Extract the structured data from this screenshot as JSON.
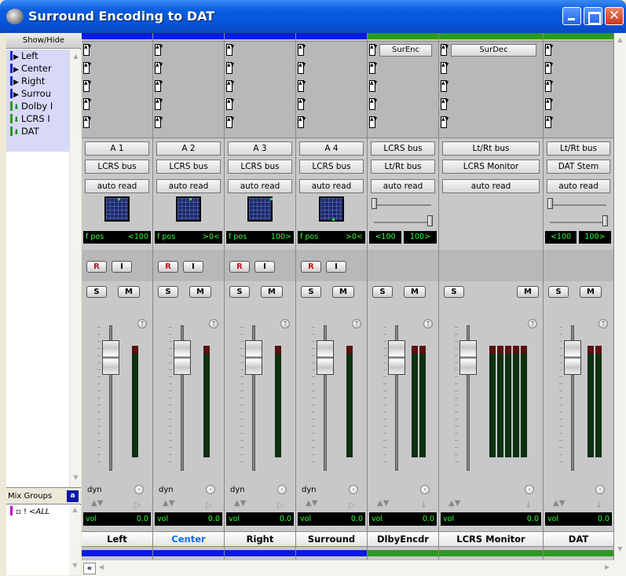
{
  "window": {
    "title": "Surround Encoding to DAT"
  },
  "left_panel": {
    "show_hide_label": "Show/Hide",
    "tracks": [
      {
        "label": "Left",
        "icon": "play-arrow-icon"
      },
      {
        "label": "Center",
        "icon": "play-arrow-icon"
      },
      {
        "label": "Right",
        "icon": "play-arrow-icon"
      },
      {
        "label": "Surrou",
        "icon": "play-arrow-icon"
      },
      {
        "label": "Dolby I",
        "icon": "down-arrow-icon"
      },
      {
        "label": "LCRS I",
        "icon": "down-arrow-icon"
      },
      {
        "label": "DAT",
        "icon": "down-arrow-icon"
      }
    ],
    "mix_groups_label": "Mix Groups",
    "mix_groups_sort": "a-z",
    "mix_group_row": {
      "tag": "▫ !",
      "name": "<ALL"
    }
  },
  "colors": {
    "audio_bar": "#0a1ae6",
    "aux_bar": "#2b9a1e",
    "meter_bg": "#0c3010",
    "display_text": "#30ff30"
  },
  "channels": [
    {
      "name": "Left",
      "input": "A 1",
      "output": "LCRS bus",
      "automation": "auto read",
      "pan_left": "f pos",
      "pan_right": "<100",
      "has_rec": true,
      "vol_label": "vol",
      "vol_value": "0.0",
      "dyn": "dyn"
    },
    {
      "name": "Center",
      "input": "A 2",
      "output": "LCRS bus",
      "automation": "auto read",
      "pan_left": "f pos",
      "pan_right": ">0<",
      "has_rec": true,
      "vol_label": "vol",
      "vol_value": "0.0",
      "dyn": "dyn",
      "selected": true
    },
    {
      "name": "Right",
      "input": "A 3",
      "output": "LCRS bus",
      "automation": "auto read",
      "pan_left": "f pos",
      "pan_right": "100>",
      "has_rec": true,
      "vol_label": "vol",
      "vol_value": "0.0",
      "dyn": "dyn"
    },
    {
      "name": "Surround",
      "input": "A 4",
      "output": "LCRS bus",
      "automation": "auto read",
      "pan_left": "f pos",
      "pan_right": ">0<",
      "has_rec": true,
      "vol_label": "vol",
      "vol_value": "0.0",
      "dyn": "dyn"
    },
    {
      "name": "DlbyEncdr",
      "plugin": "SurEnc",
      "input": "LCRS bus",
      "output": "Lt/Rt bus",
      "automation": "auto read",
      "pan_left": "<100",
      "pan_right": "100>",
      "vol_label": "vol",
      "vol_value": "0.0"
    },
    {
      "name": "LCRS Monitor",
      "plugin": "SurDec",
      "input": "Lt/Rt bus",
      "output": "LCRS Monitor",
      "automation": "auto read",
      "vol_label": "vol",
      "vol_value": "0.0"
    },
    {
      "name": "DAT",
      "input": "Lt/Rt bus",
      "output": "DAT Stem",
      "automation": "auto read",
      "pan_left": "<100",
      "pan_right": "100>",
      "vol_label": "vol",
      "vol_value": "0.0"
    }
  ],
  "buttons": {
    "rec": "R",
    "input": "I",
    "solo": "S",
    "mute": "M"
  },
  "horizontal_scroll": {
    "zoom_label": "«"
  }
}
